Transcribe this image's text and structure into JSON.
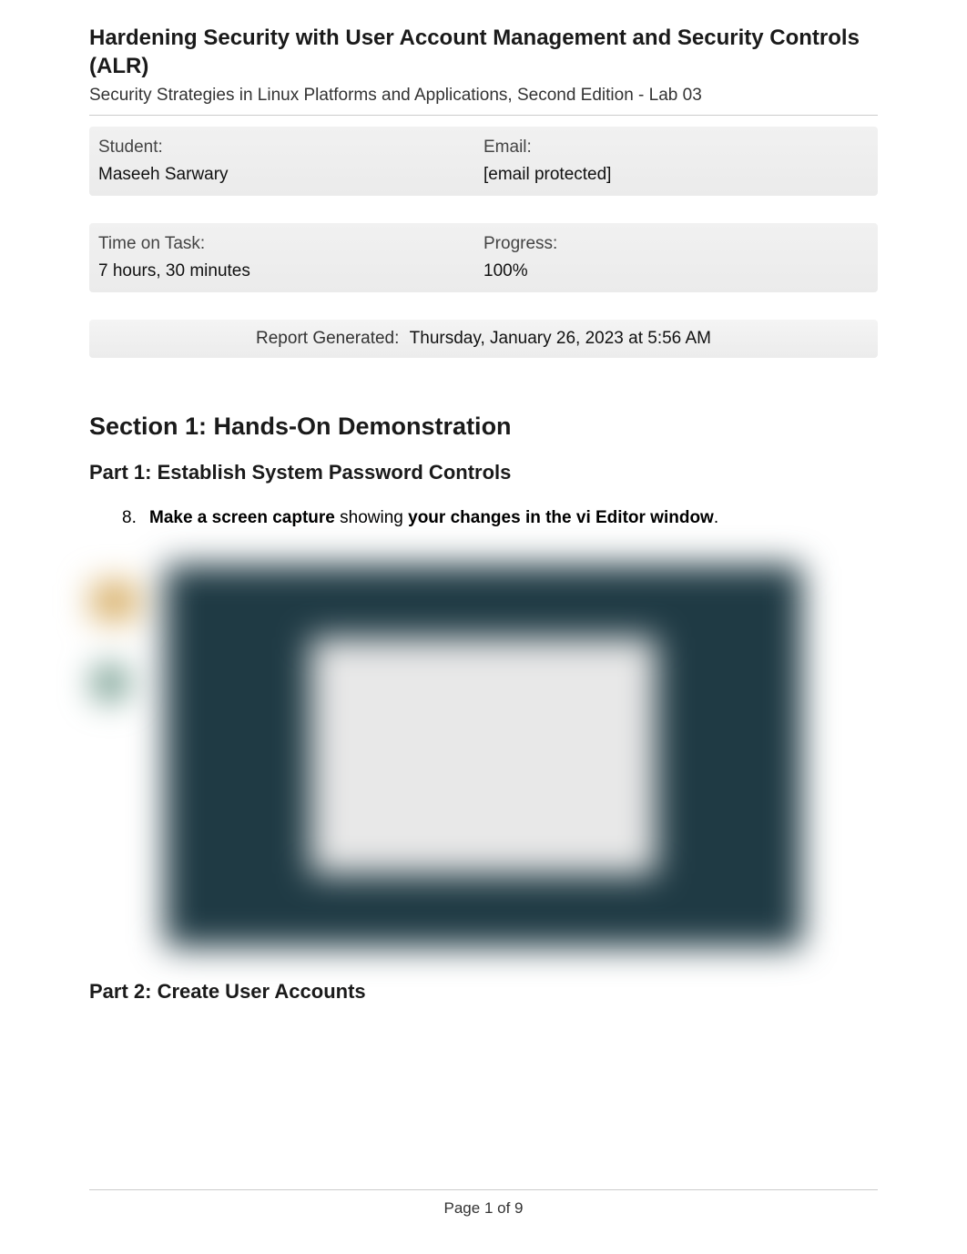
{
  "header": {
    "title": "Hardening Security with User Account Management and Security Controls (ALR)",
    "subtitle": "Security Strategies in Linux Platforms and Applications, Second Edition - Lab 03"
  },
  "info": {
    "student_label": "Student:",
    "student_value": "Maseeh Sarwary",
    "email_label": "Email:",
    "email_value": "[email protected]",
    "time_label": "Time on Task:",
    "time_value": "7 hours, 30 minutes",
    "progress_label": "Progress:",
    "progress_value": "100%"
  },
  "report": {
    "label": "Report Generated:",
    "value": "Thursday, January 26, 2023 at 5:56 AM"
  },
  "section1": {
    "heading": "Section 1: Hands-On Demonstration",
    "part1": {
      "heading": "Part 1: Establish System Password Controls",
      "item_number": "8.",
      "item_bold1": "Make a screen capture",
      "item_mid": " showing ",
      "item_bold2": "your changes in the vi Editor window",
      "item_end": "."
    },
    "part2": {
      "heading": "Part 2: Create User Accounts"
    }
  },
  "footer": {
    "page_text": "Page 1 of 9"
  }
}
